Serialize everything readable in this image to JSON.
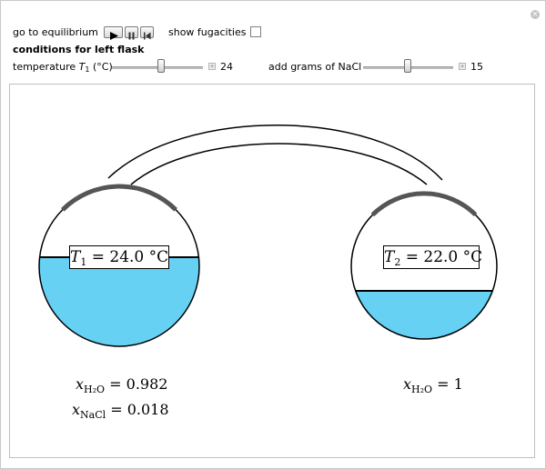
{
  "controls": {
    "equilibrium_label": "go to equilibrium",
    "fugacities_label": "show fugacities",
    "fugacities_checked": false,
    "left_flask_heading": "conditions for left flask",
    "temperature_label": "temperature",
    "temperature_symbol": "T",
    "temperature_sub": "1",
    "temperature_unit": "(°C)",
    "temperature_value": "24",
    "nacl_label": "add grams of NaCl",
    "nacl_value": "15"
  },
  "icons": {
    "play": "play-icon",
    "pause": "pause-icon",
    "reset": "step-back-icon",
    "close": "close-icon"
  },
  "colors": {
    "liquid": "#66d1f2",
    "flask_stroke": "#000000",
    "stopper": "#555555"
  },
  "left_flask": {
    "temp_symbol": "T",
    "temp_sub": "1",
    "temp_text": " = 24.0 °C",
    "x_h2o_symbol": "x",
    "x_h2o_sub": "H₂O",
    "x_h2o_value": " = 0.982",
    "x_nacl_symbol": "x",
    "x_nacl_sub": "NaCl",
    "x_nacl_value": " = 0.018"
  },
  "right_flask": {
    "temp_symbol": "T",
    "temp_sub": "2",
    "temp_text": " = 22.0 °C",
    "x_h2o_symbol": "x",
    "x_h2o_sub": "H₂O",
    "x_h2o_value": " = 1"
  }
}
